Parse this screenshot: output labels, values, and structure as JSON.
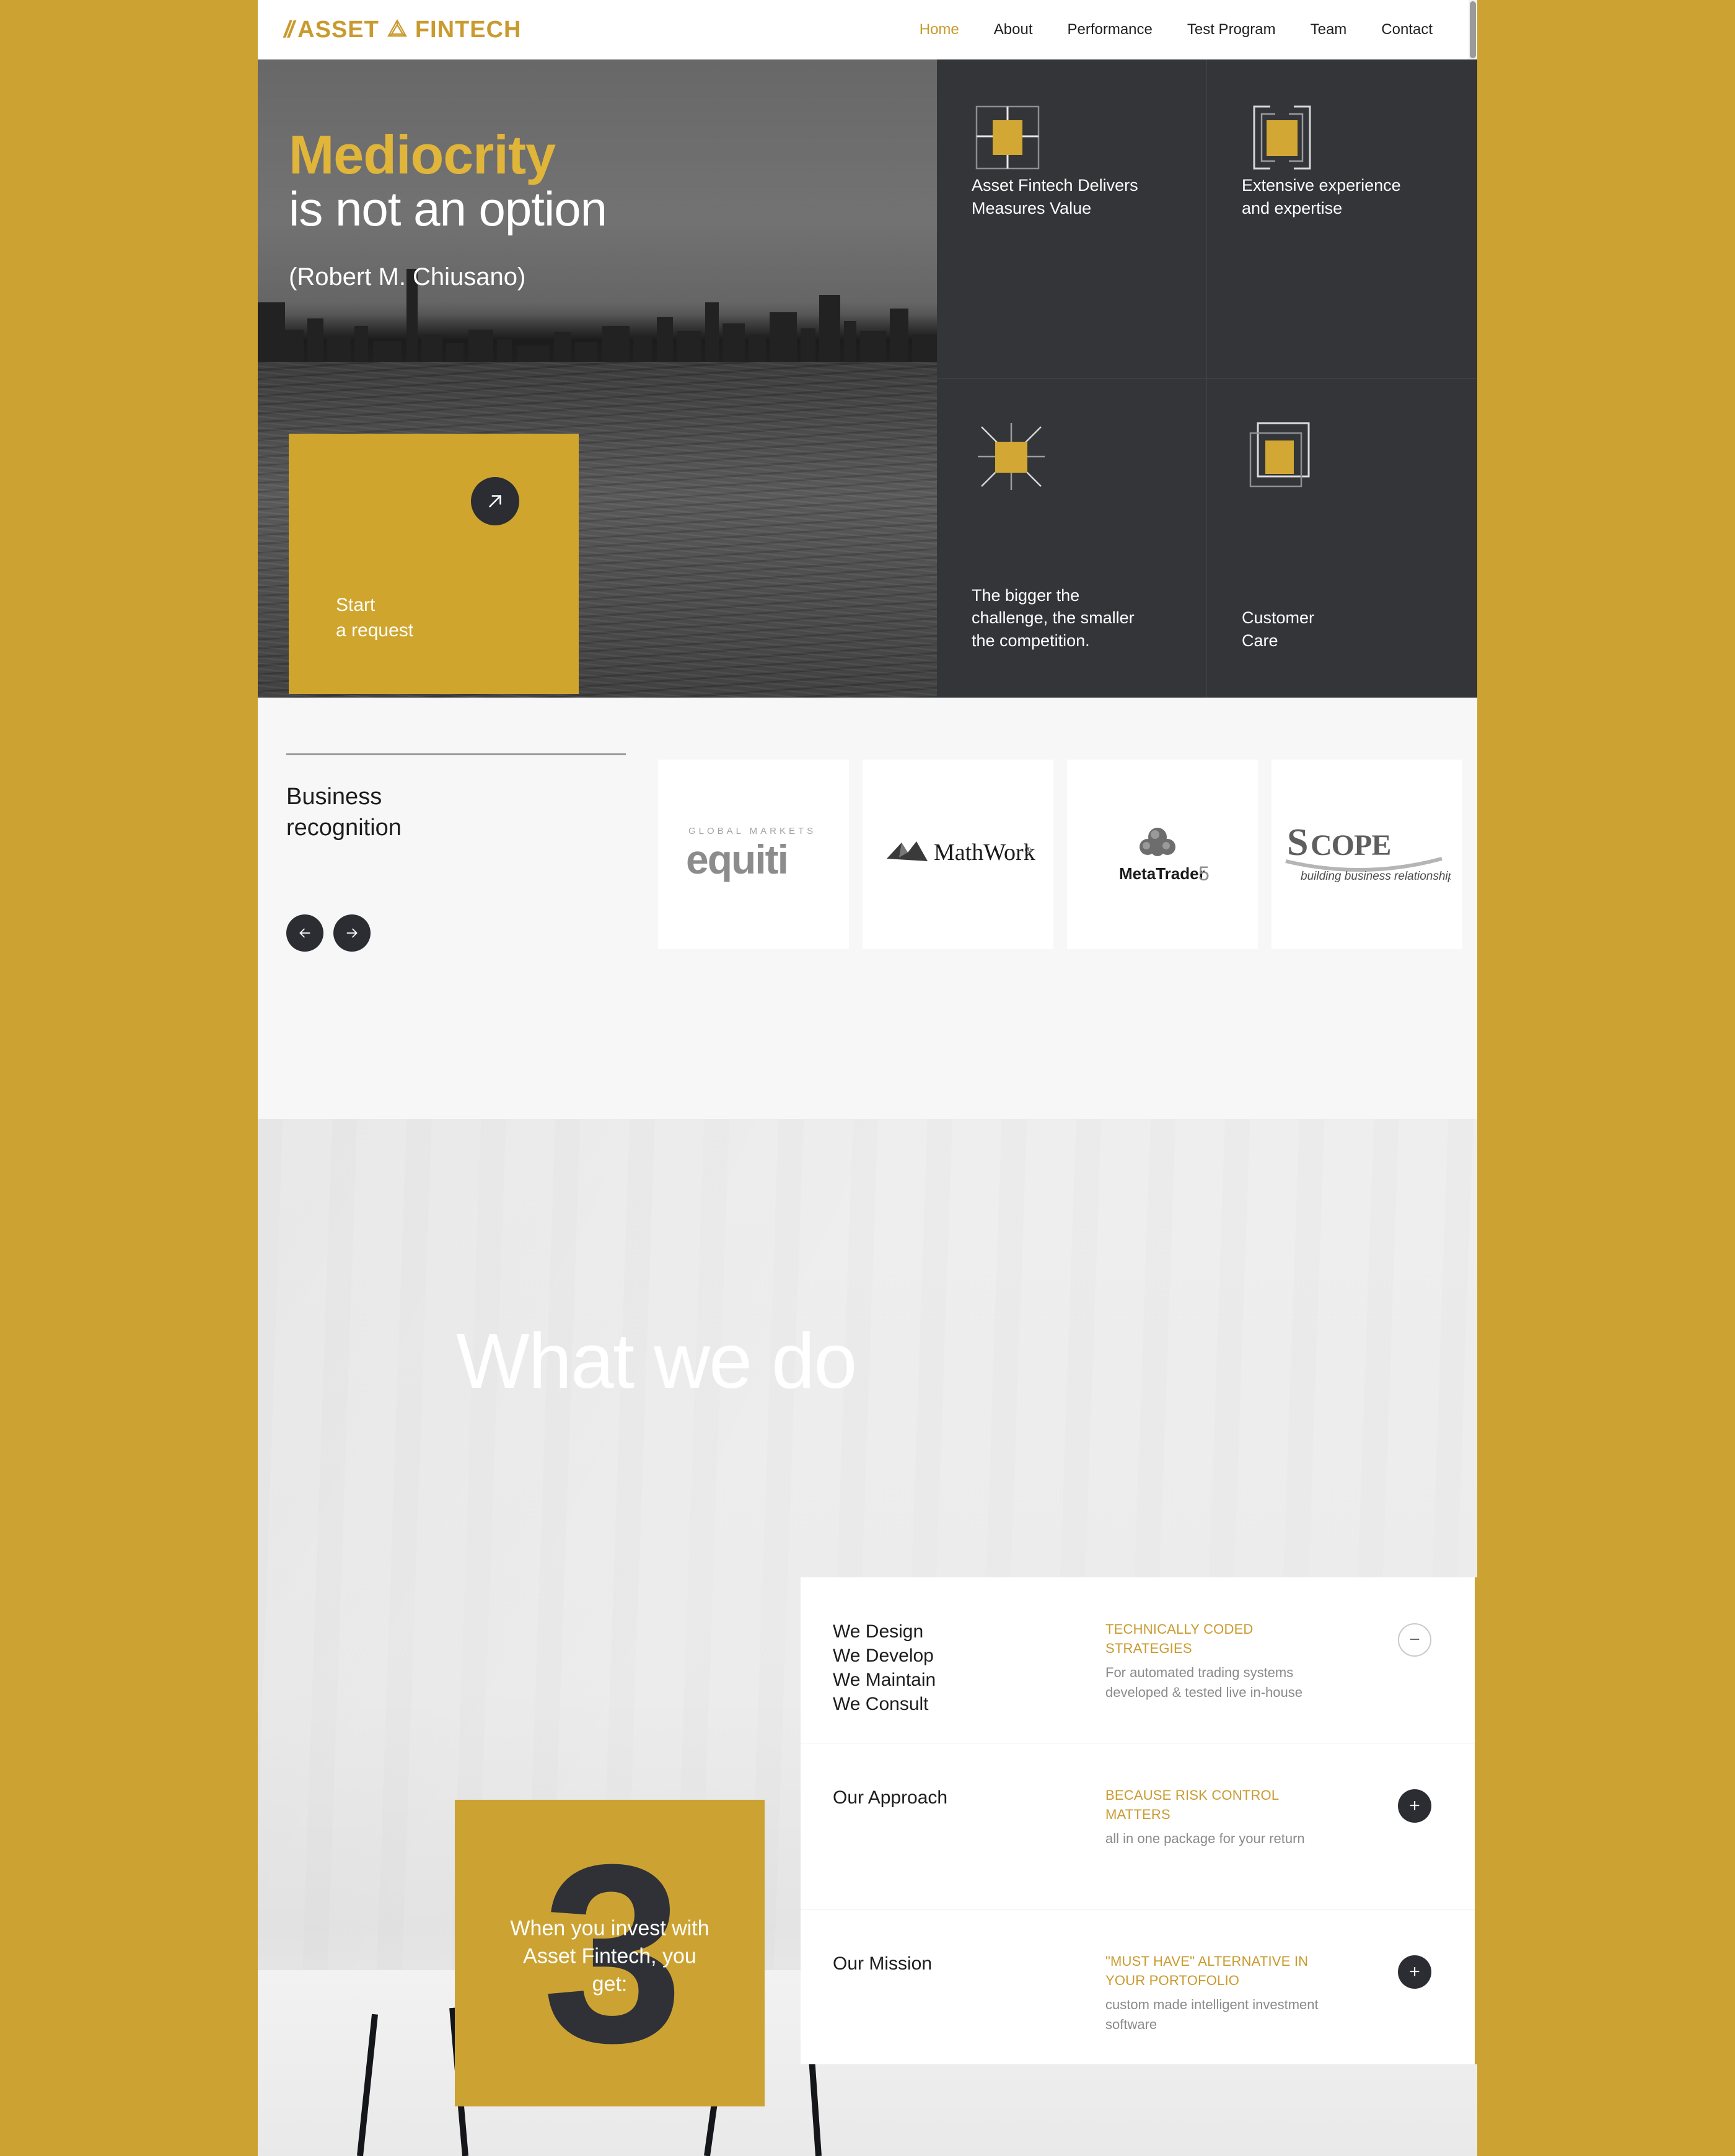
{
  "brand": {
    "logo_text_left": "ASSET",
    "logo_text_right": "FINTECH",
    "accent_color": "#C99A2E",
    "gold_color": "#CCA333",
    "dark_color": "#2b2d33"
  },
  "nav": {
    "items": [
      {
        "label": "Home",
        "active": true
      },
      {
        "label": "About",
        "active": false
      },
      {
        "label": "Performance",
        "active": false
      },
      {
        "label": "Test Program",
        "active": false
      },
      {
        "label": "Team",
        "active": false
      },
      {
        "label": "Contact",
        "active": false
      }
    ]
  },
  "hero": {
    "headline_accent": "Mediocrity",
    "headline_rest": "is not an option",
    "author": "(Robert M. Chiusano)",
    "cta": {
      "line1": "Start",
      "line2": "a request",
      "icon": "arrow-up-right-icon"
    },
    "tiles": [
      {
        "icon": "crosshair-square-icon",
        "title_line1": "Asset Fintech Delivers",
        "title_line2": "Measures Value"
      },
      {
        "icon": "bracket-frame-icon",
        "title_line1": "Extensive experience",
        "title_line2": "and expertise"
      },
      {
        "icon": "burst-square-icon",
        "title_line1": "The bigger the",
        "title_line2": "challenge, the smaller",
        "title_line3": "the competition."
      },
      {
        "icon": "layered-frames-icon",
        "title_line1": "Customer",
        "title_line2": "Care"
      }
    ]
  },
  "recognition": {
    "title_line1": "Business",
    "title_line2": "recognition",
    "prev_icon": "arrow-left-icon",
    "next_icon": "arrow-right-icon",
    "logos": [
      {
        "name": "equiti-logo",
        "sup": "GLOBAL MARKETS",
        "main": "equiti"
      },
      {
        "name": "mathworks-logo",
        "main": "MathWorks",
        "sup": "®"
      },
      {
        "name": "metatrader-logo",
        "main": "MetaTrader",
        "sup": "5"
      },
      {
        "name": "scope-logo",
        "main": "SCOPE",
        "sub": "building business relationships"
      }
    ]
  },
  "whatwedo": {
    "title": "What we do",
    "number_card": {
      "number": "3",
      "label_line1": "When you invest with",
      "label_line2": "Asset Fintech, you",
      "label_line3": "get:"
    },
    "accordion": [
      {
        "label_lines": [
          "We Design",
          "We Develop",
          "We Maintain",
          "We Consult"
        ],
        "kicker_line1": "TECHNICALLY CODED",
        "kicker_line2": "STRATEGIES",
        "sub_line1": "For automated trading systems",
        "sub_line2": "developed & tested live in-house",
        "state": "open",
        "toggle_glyph": "−"
      },
      {
        "label_lines": [
          "Our Approach"
        ],
        "kicker_line1": "BECAUSE RISK CONTROL",
        "kicker_line2": "MATTERS",
        "sub_line1": "all in one package for your return",
        "sub_line2": "",
        "state": "closed",
        "toggle_glyph": "+"
      },
      {
        "label_lines": [
          "Our Mission"
        ],
        "kicker_line1": "\"MUST HAVE\" ALTERNATIVE IN",
        "kicker_line2": "YOUR PORTOFOLIO",
        "sub_line1": "custom made intelligent investment",
        "sub_line2": "software",
        "state": "closed",
        "toggle_glyph": "+"
      }
    ]
  }
}
